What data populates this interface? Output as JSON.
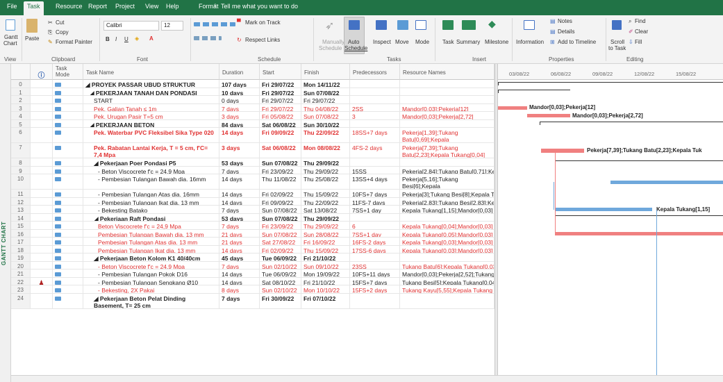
{
  "menu": {
    "tabs": [
      "File",
      "Task",
      "Resource",
      "Report",
      "Project",
      "View",
      "Help",
      "Format"
    ],
    "active": "Task",
    "tellme": "Tell me what you want to do"
  },
  "ribbon": {
    "view": {
      "gantt": "Gantt",
      "chart": "Chart",
      "group": "View"
    },
    "clipboard": {
      "paste": "Paste",
      "cut": "Cut",
      "copy": "Copy",
      "format_painter": "Format Painter",
      "group": "Clipboard"
    },
    "font": {
      "name": "Calibri",
      "size": "12",
      "group": "Font"
    },
    "schedule": {
      "mark_on_track": "Mark on Track",
      "respect_links": "Respect Links",
      "group": "Schedule"
    },
    "tasks": {
      "manually": "Manually",
      "schedule_word": "Schedule",
      "auto": "Auto",
      "inspect": "Inspect",
      "move": "Move",
      "mode": "Mode",
      "group": "Tasks"
    },
    "insert": {
      "task": "Task",
      "summary": "Summary",
      "milestone": "Milestone",
      "group": "Insert"
    },
    "properties": {
      "information": "Information",
      "notes": "Notes",
      "details": "Details",
      "add_timeline": "Add to Timeline",
      "group": "Properties"
    },
    "editing": {
      "scroll": "Scroll",
      "to_task": "to Task",
      "find": "Find",
      "clear": "Clear",
      "fill": "Fill",
      "group": "Editing"
    }
  },
  "side_label": "GANTT CHART",
  "columns": {
    "mode_line1": "Task",
    "mode_line2": "Mode",
    "name": "Task Name",
    "duration": "Duration",
    "start": "Start",
    "finish": "Finish",
    "pred": "Predecessors",
    "resources": "Resource Names"
  },
  "rows": [
    {
      "id": "0",
      "name": "◢ PROYEK PASSAR UBUD STRUKTUR",
      "indent": 0,
      "bold": true,
      "red": false,
      "duration": "107 days",
      "start": "Fri 29/07/22",
      "finish": "Mon 14/11/22",
      "pred": "",
      "res": ""
    },
    {
      "id": "1",
      "name": "◢ PEKERJAAN TANAH DAN PONDASI",
      "indent": 1,
      "bold": true,
      "red": false,
      "duration": "10 days",
      "start": "Fri 29/07/22",
      "finish": "Sun 07/08/22",
      "pred": "",
      "res": ""
    },
    {
      "id": "2",
      "name": "START",
      "indent": 2,
      "bold": false,
      "red": false,
      "duration": "0 days",
      "start": "Fri 29/07/22",
      "finish": "Fri 29/07/22",
      "pred": "",
      "res": ""
    },
    {
      "id": "3",
      "name": "Pek. Galian Tanah ≤ 1m",
      "indent": 2,
      "bold": false,
      "red": true,
      "duration": "7 days",
      "start": "Fri 29/07/22",
      "finish": "Thu 04/08/22",
      "pred": "2SS",
      "res": "Mandor[0,03];Pekerja[12]"
    },
    {
      "id": "4",
      "name": "Pek. Urugan Pasir T=5 cm",
      "indent": 2,
      "bold": false,
      "red": true,
      "duration": "3 days",
      "start": "Fri 05/08/22",
      "finish": "Sun 07/08/22",
      "pred": "3",
      "res": "Mandor[0,03];Pekerja[2,72]"
    },
    {
      "id": "5",
      "name": "◢ PEKERJAAN BETON",
      "indent": 1,
      "bold": true,
      "red": false,
      "duration": "84 days",
      "start": "Sat 06/08/22",
      "finish": "Sun 30/10/22",
      "pred": "",
      "res": ""
    },
    {
      "id": "6",
      "name": "Pek. Waterbar PVC Fleksibel Sika Type 020",
      "indent": 2,
      "bold": true,
      "red": true,
      "wrap": true,
      "duration": "14 days",
      "start": "Fri 09/09/22",
      "finish": "Thu 22/09/22",
      "pred": "18SS+7 days",
      "res": "Pekerja[1,39];Tukang Batu[0,69];Kepala Tukang[0,04];Mandor[0,03]"
    },
    {
      "id": "7",
      "name": "Pek. Rabatan Lantai Kerja, T = 5 cm, f'C= 7,4 Mpa",
      "indent": 2,
      "bold": true,
      "red": true,
      "wrap": true,
      "duration": "3 days",
      "start": "Sat 06/08/22",
      "finish": "Mon 08/08/22",
      "pred": "4FS-2 days",
      "res": "Pekerja[7,39];Tukang Batu[2,23];Kepala Tukang[0,04]"
    },
    {
      "id": "8",
      "name": "◢ Pekerjaan Poer Pondasi P5",
      "indent": 2,
      "bold": true,
      "red": false,
      "duration": "53 days",
      "start": "Sun 07/08/22",
      "finish": "Thu 29/09/22",
      "pred": "",
      "res": ""
    },
    {
      "id": "9",
      "name": "- Beton Viscocrete f'c = 24,9 Mpa",
      "indent": 3,
      "bold": false,
      "red": false,
      "duration": "7 days",
      "start": "Fri 23/09/22",
      "finish": "Thu 29/09/22",
      "pred": "15SS",
      "res": "Pekerja[2,84];Tukang Batu[0,71];Kepala"
    },
    {
      "id": "10",
      "name": "- Pembesian Tulangan Bawah dia. 16mm",
      "indent": 3,
      "bold": false,
      "red": false,
      "wrap": true,
      "duration": "14 days",
      "start": "Thu 11/08/22",
      "finish": "Thu 25/08/22",
      "pred": "13SS+4 days",
      "res": "Pekerja[5,16];Tukang Besi[6];Kepala Tukang[1,87];Mandor[0,02]"
    },
    {
      "id": "11",
      "name": "- Pembesian Tulangan Atas dia. 16mm",
      "indent": 3,
      "bold": false,
      "red": false,
      "duration": "14 days",
      "start": "Fri 02/09/22",
      "finish": "Thu 15/09/22",
      "pred": "10FS+7 days",
      "res": "Pekerja[3];Tukang Besi[8];Kepala Tukang"
    },
    {
      "id": "12",
      "name": "- Pembesian Tulangan Ikat dia. 13 mm",
      "indent": 3,
      "bold": false,
      "red": false,
      "duration": "14 days",
      "start": "Fri 09/09/22",
      "finish": "Thu 22/09/22",
      "pred": "11FS-7 days",
      "res": "Pekerja[2,83];Tukang Besi[2,83];Kepala"
    },
    {
      "id": "13",
      "name": "- Bekesting Batako",
      "indent": 3,
      "bold": false,
      "red": false,
      "duration": "7 days",
      "start": "Sun 07/08/22",
      "finish": "Sat 13/08/22",
      "pred": "7SS+1 day",
      "res": "Kepala Tukang[1,15];Mandor[0,03]"
    },
    {
      "id": "14",
      "name": "◢ Pekerjaan Raft Pondasi",
      "indent": 2,
      "bold": true,
      "red": false,
      "duration": "53 days",
      "start": "Sun 07/08/22",
      "finish": "Thu 29/09/22",
      "pred": "",
      "res": ""
    },
    {
      "id": "15",
      "name": "Beton Viscocrete f'c = 24,9 Mpa",
      "indent": 3,
      "bold": false,
      "red": true,
      "duration": "7 days",
      "start": "Fri 23/09/22",
      "finish": "Thu 29/09/22",
      "pred": "6",
      "res": "Kepala Tukang[0,04];Mandor[0,03]"
    },
    {
      "id": "16",
      "name": "Pembesian Tulangan Bawah dia. 13 mm",
      "indent": 3,
      "bold": false,
      "red": true,
      "duration": "21 days",
      "start": "Sun 07/08/22",
      "finish": "Sun 28/08/22",
      "pred": "7SS+1 day",
      "res": "Kepala Tukang[0,05];Mandor[0,03]"
    },
    {
      "id": "17",
      "name": "Pembesian Tulangan Atas dia. 13 mm",
      "indent": 3,
      "bold": false,
      "red": true,
      "duration": "21 days",
      "start": "Sat 27/08/22",
      "finish": "Fri 16/09/22",
      "pred": "16FS-2 days",
      "res": "Kepala Tukang[0,03];Mandor[0,03]"
    },
    {
      "id": "18",
      "name": "Pembesian Tulangan Ikat dia. 13 mm",
      "indent": 3,
      "bold": false,
      "red": true,
      "duration": "14 days",
      "start": "Fri 02/09/22",
      "finish": "Thu 15/09/22",
      "pred": "17SS-6 days",
      "res": "Kepala Tukang[0,03];Mandor[0,03]"
    },
    {
      "id": "19",
      "name": "◢ Pekerjaan Beton Kolom K1 40/40cm",
      "indent": 2,
      "bold": true,
      "red": false,
      "duration": "45 days",
      "start": "Tue 06/09/22",
      "finish": "Fri 21/10/22",
      "pred": "",
      "res": ""
    },
    {
      "id": "20",
      "name": "- Beton Viscocrete f'c = 24,9 Mpa",
      "indent": 3,
      "bold": false,
      "red": true,
      "duration": "7 days",
      "start": "Sun 02/10/22",
      "finish": "Sun 09/10/22",
      "pred": "23SS",
      "res": "Tukang Batu[6];Kepala Tukang[0,03]"
    },
    {
      "id": "21",
      "name": "- Pembesian Tulangan Pokok D16",
      "indent": 3,
      "bold": false,
      "red": false,
      "duration": "14 days",
      "start": "Tue 06/09/22",
      "finish": "Mon 19/09/22",
      "pred": "10FS+11 days",
      "res": "Mandor[0,03];Pekerja[2,52];Tukang"
    },
    {
      "id": "22",
      "name": "- Pembesian Tulangan Sengkang Ø10",
      "indent": 3,
      "bold": false,
      "red": false,
      "duration": "14 days",
      "start": "Sat 08/10/22",
      "finish": "Fri 21/10/22",
      "pred": "15FS+7 days",
      "res": "Tukang Besi[5];Kepala Tukang[0,04]",
      "indicator": true
    },
    {
      "id": "23",
      "name": "- Bekesting, 2X Pakai",
      "indent": 3,
      "bold": false,
      "red": true,
      "duration": "8 days",
      "start": "Sun 02/10/22",
      "finish": "Mon 10/10/22",
      "pred": "15FS+2 days",
      "res": "Tukang Kayu[5,55];Kepala Tukang"
    },
    {
      "id": "24",
      "name": "◢ Pekerjaan Beton Pelat Dinding Basement, T= 25 cm",
      "indent": 2,
      "bold": true,
      "red": false,
      "wrap": true,
      "duration": "7 days",
      "start": "Fri 30/09/22",
      "finish": "Fri 07/10/22",
      "pred": "",
      "res": ""
    }
  ],
  "timeline": {
    "dates": [
      "03/08/22",
      "06/08/22",
      "09/08/22",
      "12/08/22",
      "15/08/22"
    ]
  },
  "gantt_labels": {
    "r3": "Mandor[0,03];Pekerja[12]",
    "r4": "Mandor[0,03];Pekerja[2,72]",
    "r7": "Pekerja[7,39];Tukang Batu[2,23];Kepala Tuk",
    "r13": "Kepala Tukang[1,15]"
  },
  "colors": {
    "ribbon_green": "#217346",
    "critical_bar": "#f08080",
    "normal_bar": "#6fa8dc"
  }
}
